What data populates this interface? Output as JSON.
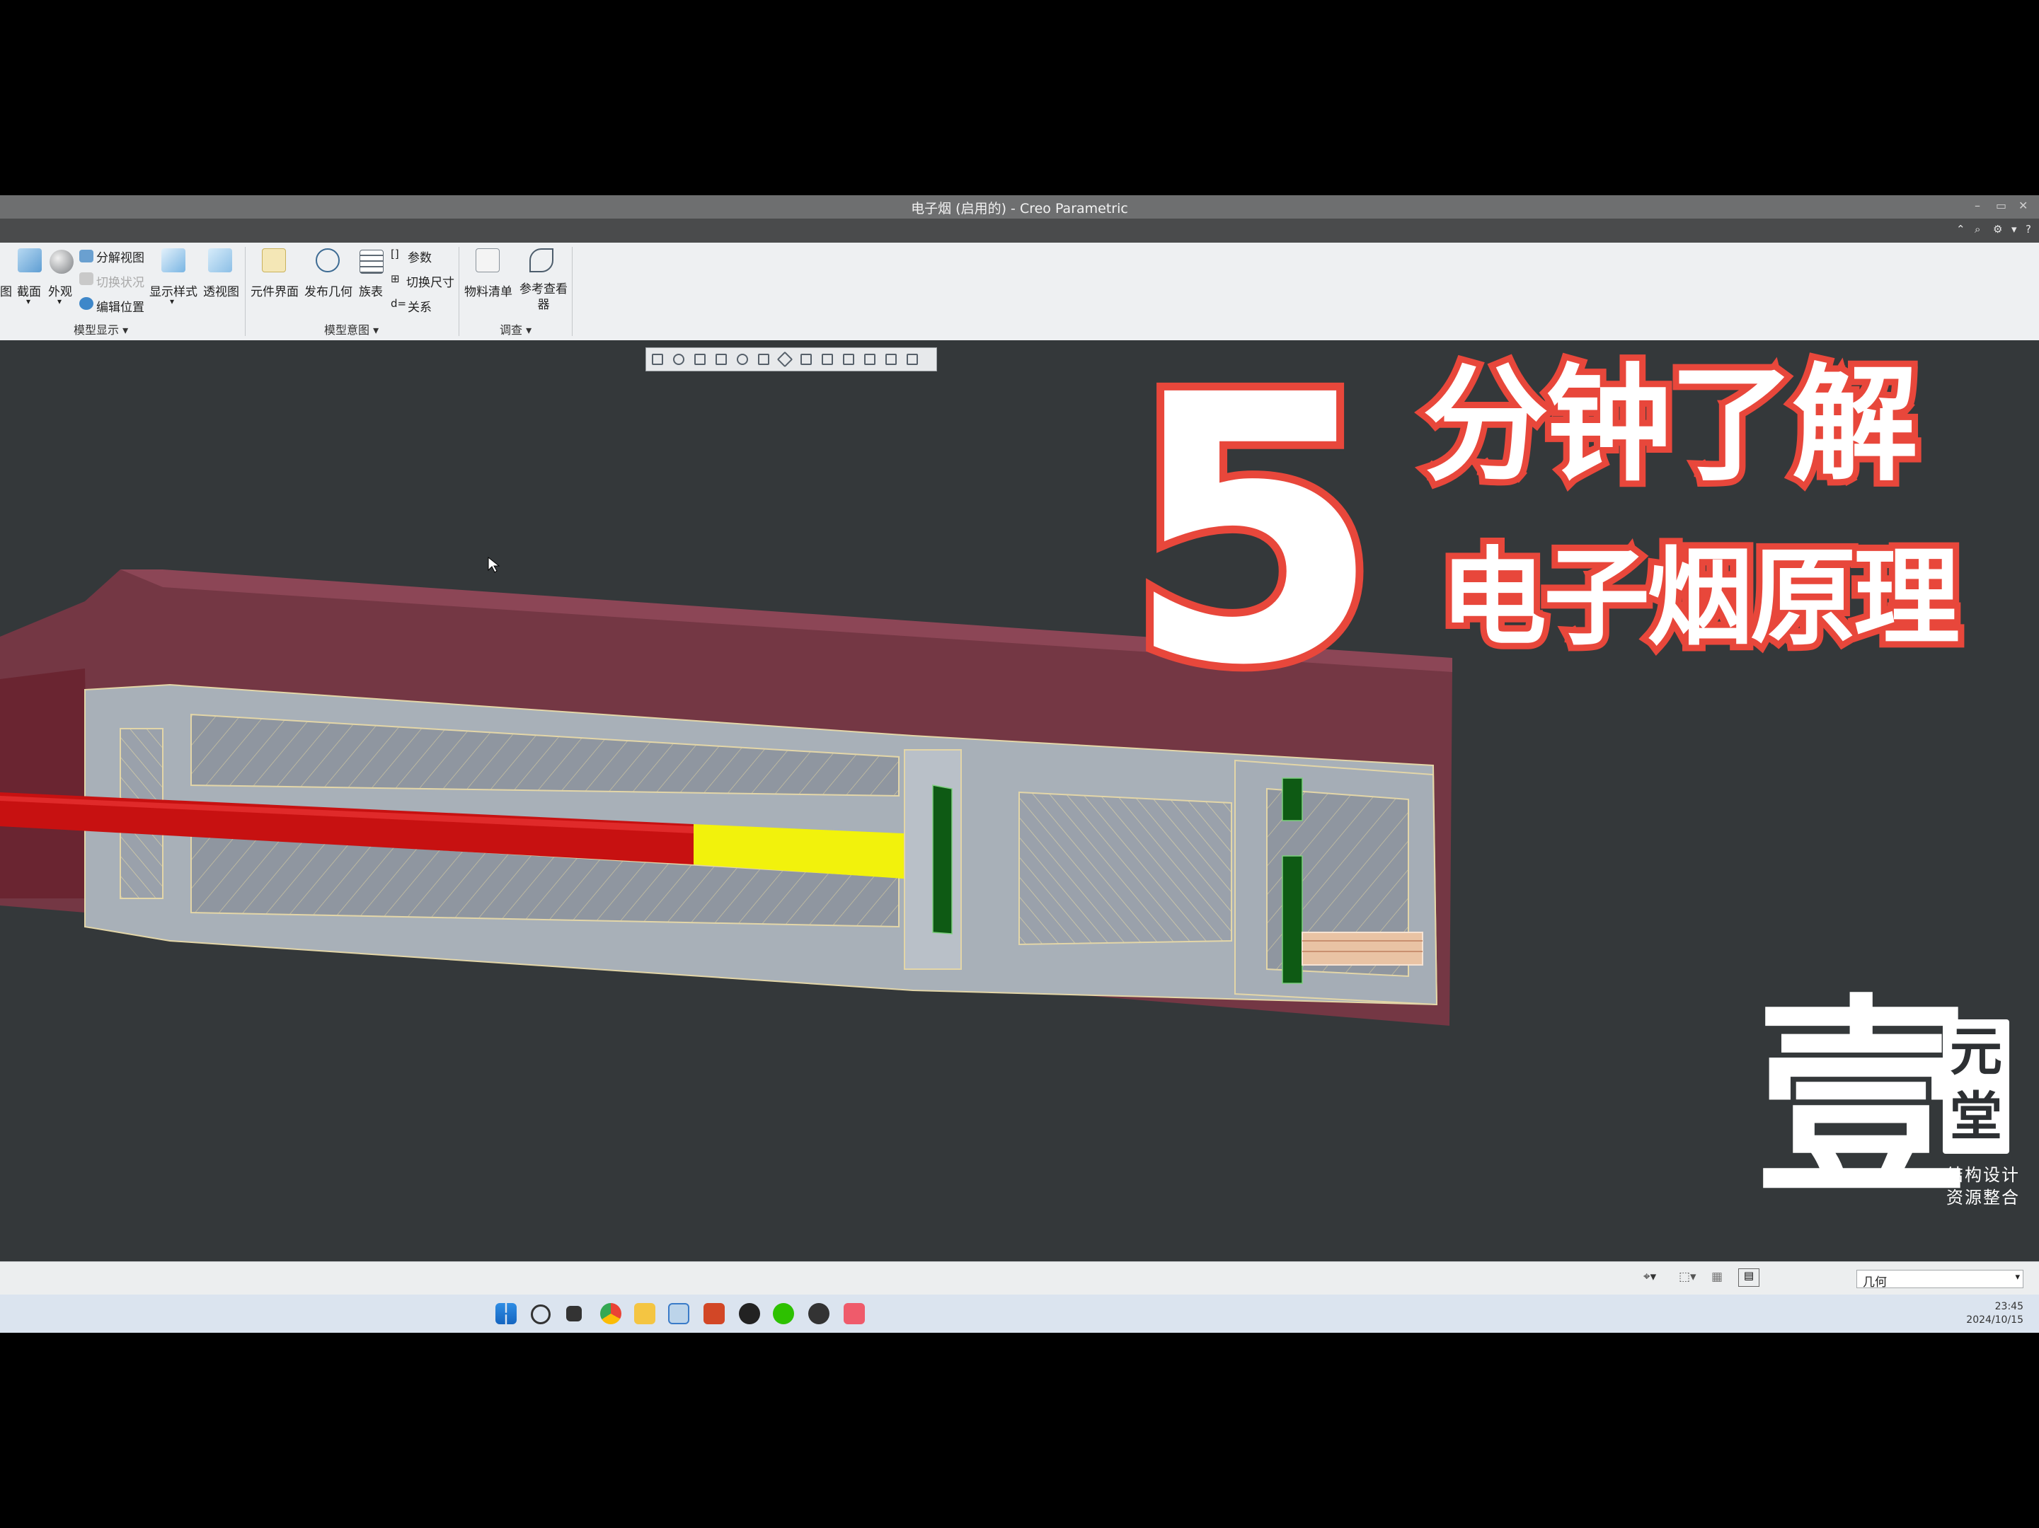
{
  "window": {
    "title": "电子烟 (启用的) - Creo Parametric"
  },
  "ribbon": {
    "model_display": {
      "group_label": "模型显示",
      "items": [
        "图",
        "截面",
        "外观",
        "显示样式",
        "透视图"
      ],
      "small_items": [
        "分解视图",
        "切换状况",
        "编辑位置"
      ]
    },
    "model_intent": {
      "group_label": "模型意图",
      "items": [
        "元件界面",
        "发布几何",
        "族表"
      ],
      "small_items": [
        "参数",
        "切换尺寸",
        "关系"
      ]
    },
    "investigate": {
      "group_label": "调查",
      "items": [
        "物料清单",
        "参考查看器"
      ]
    }
  },
  "overlay": {
    "number": "5",
    "line1": "分钟了解",
    "line2": "电子烟原理"
  },
  "logo": {
    "main_char": "壹",
    "side_chars": "元堂",
    "tagline1": "结构设计",
    "tagline2": "资源整合"
  },
  "statusbar": {
    "filter_value": "几何"
  },
  "taskbar": {
    "time": "23:45",
    "date": "2024/10/15"
  },
  "colors": {
    "viewport_bg": "#34383a",
    "overlay_accent": "#e8473b",
    "housing": "#7a3745",
    "section_fill": "#8f96a0",
    "tube_red": "#c71111",
    "tube_yellow": "#f2f20c",
    "seal_green": "#0e5a14"
  }
}
